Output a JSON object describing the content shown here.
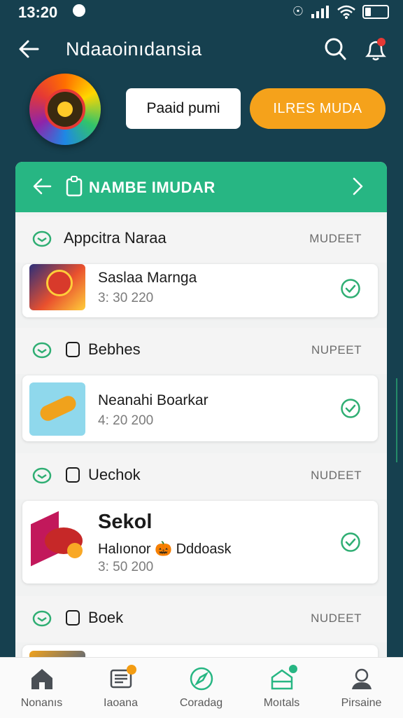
{
  "status_bar": {
    "time": "13:20"
  },
  "header": {
    "title": "Ndaaoinıdansia"
  },
  "actions": {
    "primary_label": "Paaid pumi",
    "accent_label": "ILRES MUDA"
  },
  "panel": {
    "title": "NAMBE IMUDAR",
    "sections": [
      {
        "label": "Appcitra Naraa",
        "status": "MUDEET",
        "item": {
          "title": "Saslaa Marnga",
          "meta": "3: 30 220"
        }
      },
      {
        "label": "Bebhes",
        "status": "NUPEET",
        "item": {
          "title": "Neanahi Boarkar",
          "meta": "4: 20 200"
        }
      },
      {
        "label": "Uechok",
        "status": "NUDEET",
        "item": {
          "title": "Sekol",
          "subtitle": "Halıonor 🎃 Dddoask",
          "meta": "3: 50 200"
        }
      },
      {
        "label": "Boek",
        "status": "NUDEET"
      }
    ]
  },
  "bottom_nav": [
    {
      "label": "Nonanıs"
    },
    {
      "label": "Iaoana"
    },
    {
      "label": "Coradag"
    },
    {
      "label": "Moıtals"
    },
    {
      "label": "Pirsaine"
    }
  ],
  "colors": {
    "background": "#16404f",
    "panel_header": "#27b683",
    "accent_button": "#f5a21b",
    "check": "#2fae73",
    "badge_orange": "#f39c12",
    "badge_red": "#e53935"
  },
  "icons": {
    "header": [
      "back-arrow-icon",
      "search-icon",
      "bell-icon"
    ],
    "panel": [
      "chevron-left-icon",
      "clipboard-icon",
      "chevron-right-icon"
    ],
    "nav": [
      "home-icon",
      "news-icon",
      "compass-icon",
      "briefcase-icon",
      "profile-icon"
    ]
  }
}
